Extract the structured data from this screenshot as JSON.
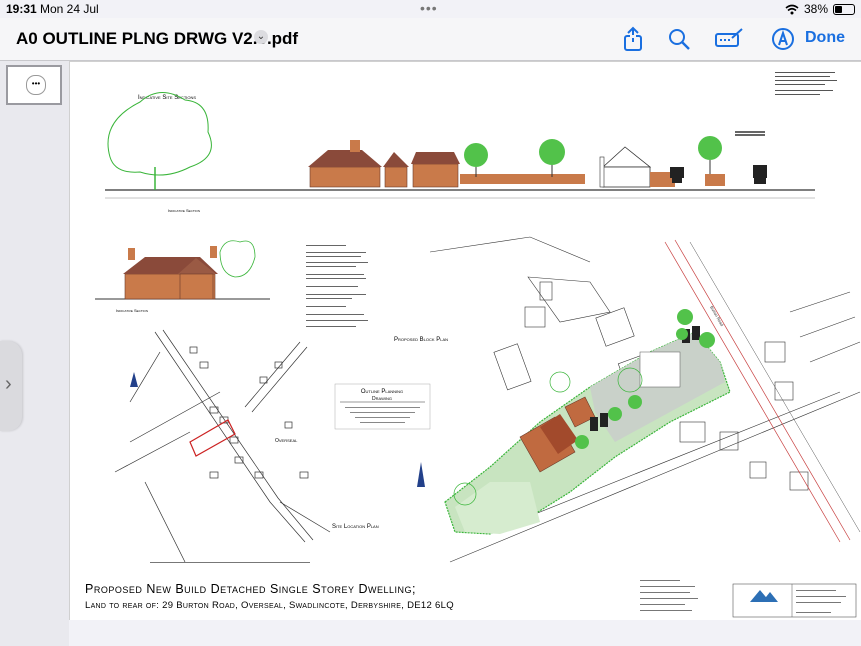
{
  "status_bar": {
    "time": "19:31",
    "date": "Mon 24 Jul",
    "battery": "38%",
    "battery_level": 0.38
  },
  "toolbar": {
    "document_title": "A0 OUTLINE PLNG DRWG V2.0.pdf",
    "done_label": "Done",
    "icons": [
      "share-icon",
      "search-icon",
      "markup-icon",
      "annotate-icon"
    ]
  },
  "colors": {
    "accent": "#1a6fe0",
    "tree_green": "#52c24a",
    "brick": "#c97a4a",
    "roof": "#8a4a3a",
    "site_red": "#cc2222"
  },
  "drawing": {
    "labels": {
      "indicative_site_sections": "Indicative Site Sections",
      "indicative_section_1": "Indicative Section",
      "indicative_section_2": "Indicative Section",
      "proposed_block_plan": "Proposed Block Plan",
      "outline_planning": "Outline Planning",
      "drawing": "Drawing",
      "overseal": "Overseal",
      "site_location_plan": "Site Location Plan",
      "burton_road": "Burton Road"
    },
    "title_main": "Proposed New Build Detached Single Storey Dwelling;",
    "title_sub": "Land to rear of: 29 Burton Road, Overseal, Swadlincote, Derbyshire, DE12 6LQ"
  }
}
